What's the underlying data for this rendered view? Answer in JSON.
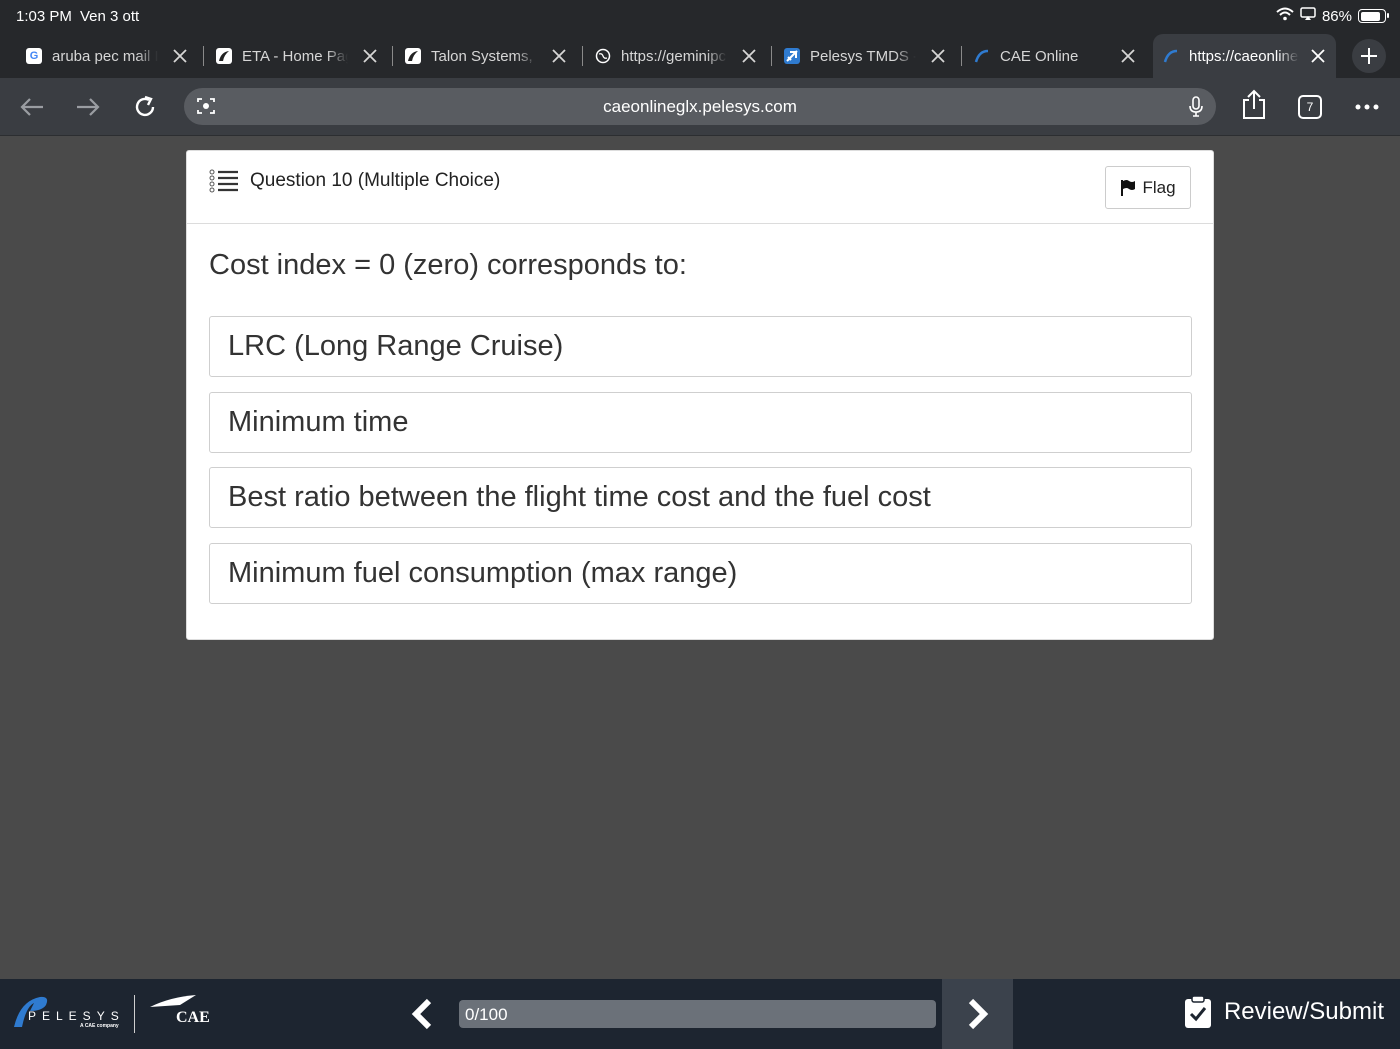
{
  "status_bar": {
    "time": "1:03 PM",
    "date": "Ven 3 ott",
    "battery": "86%",
    "battery_level": 0.86
  },
  "tabs": [
    {
      "label": "aruba pec mail I",
      "icon": "google-icon"
    },
    {
      "label": "ETA - Home Pag",
      "icon": "eta-icon"
    },
    {
      "label": "Talon Systems,",
      "icon": "talon-icon"
    },
    {
      "label": "https://geminipc",
      "icon": "globe-icon"
    },
    {
      "label": "Pelesys TMDS -",
      "icon": "plane-icon"
    },
    {
      "label": "CAE Online",
      "icon": "cae-icon"
    },
    {
      "label": "https://caeonline",
      "icon": "cae-icon",
      "active": true
    }
  ],
  "toolbar": {
    "url": "caeonlineglx.pelesys.com",
    "tab_count": "7"
  },
  "question": {
    "title": "Question 10 (Multiple Choice)",
    "flag_label": "Flag",
    "text": "Cost index = 0 (zero) corresponds to:",
    "options": [
      "LRC (Long Range Cruise)",
      "Minimum time",
      "Best ratio between the flight time cost and the fuel cost",
      "Minimum fuel consumption (max range)"
    ]
  },
  "footer": {
    "brand": "PELESYS",
    "brand_sub": "A CAE company",
    "partner": "CAE",
    "progress_text": "0/100",
    "progress_value": 0,
    "review_label": "Review/Submit"
  },
  "colors": {
    "page_bg": "#4a4a4a",
    "browser_chrome": "#26282b",
    "footer_bg": "#1d2530",
    "brand_blue": "#2f7bd0"
  }
}
